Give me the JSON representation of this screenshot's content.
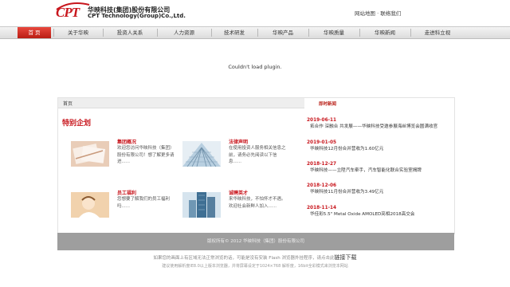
{
  "header": {
    "logo_text": "CPT",
    "company_cn": "华映科技(集团)股份有限公司",
    "company_en": "CPT Technology(Group)Co.,Ltd.",
    "site_map": "网站地图",
    "separator": "·",
    "contact": "联络我们"
  },
  "nav": {
    "items": [
      {
        "label": "首 页"
      },
      {
        "label": "关于华映"
      },
      {
        "label": "投资人关系"
      },
      {
        "label": "人力资源"
      },
      {
        "label": "技术研发"
      },
      {
        "label": "华映产品"
      },
      {
        "label": "华映质量"
      },
      {
        "label": "华映新闻"
      },
      {
        "label": "走进科立视"
      }
    ],
    "active_color": "#c8161d"
  },
  "plugin_message": "Couldn't load plugin.",
  "main": {
    "breadcrumb": "首页",
    "special_title": "特别企划",
    "tiles": [
      {
        "title": "集团概况",
        "desc": "欢迎您访问华映科技（集团）股份有限公司！想了解更多请进......",
        "icon": "documents-photo"
      },
      {
        "title": "法律声明",
        "desc": "在使用投资人服务相关信息之前，请务必先阅读以下信息......",
        "icon": "building-photo"
      },
      {
        "title": "员工福利",
        "desc": "您想要了解我们的员工福利吗......",
        "icon": "person-photo"
      },
      {
        "title": "诚聘英才",
        "desc": "来华映科技，不怕怀才不遇。欢迎社会新鲜人加入......",
        "icon": "skyscraper-photo"
      }
    ]
  },
  "news": {
    "header": "即时新闻",
    "items": [
      {
        "date": "2019-06-11",
        "text": "拓合作 深融合 共发展——华映科技受邀参展海丝博览会圆满收官"
      },
      {
        "date": "2019-01-05",
        "text": "华映科技12月份合并营收为1.60亿元"
      },
      {
        "date": "2018-12-27",
        "text": "华映科技——立陞汽车牵手，汽车智能化联合实验室揭牌"
      },
      {
        "date": "2018-12-06",
        "text": "华映科技11月份合并营收为3.49亿元"
      },
      {
        "date": "2018-11-14",
        "text": "华佳彩5.5\" Metal Oxide AMOLED亮相2018高交会"
      }
    ]
  },
  "footer": {
    "copyright": "版权所有© 2012 华映科技（集团）股份有限公司",
    "note_prefix": "如果您的画面上有区域无法正常浏览的话，可能是没有安装 Flash 浏览器外挂程序，请点击此",
    "note_link": "链接下载",
    "note2": "建议使用解析度IE8.0以上版本浏览器，并将屏幕设定于1024×768 解析度，16bit全彩模式来浏览本网站"
  }
}
